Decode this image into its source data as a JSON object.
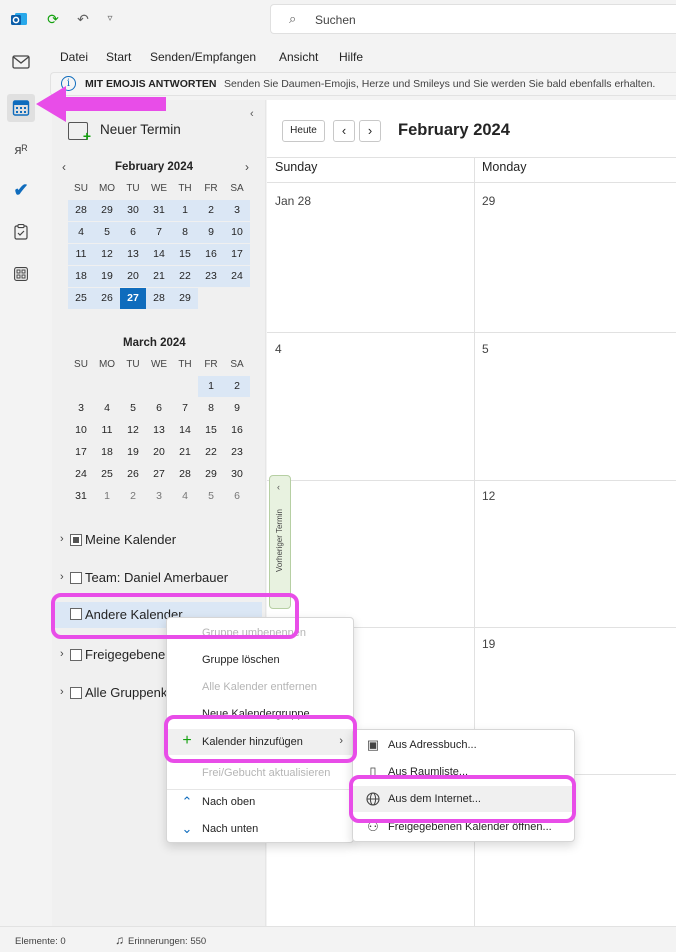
{
  "titlebar": {
    "search_placeholder": "Suchen",
    "icons": [
      "outlook-logo-icon",
      "sync-icon",
      "undo-icon",
      "customize-dropdown-icon"
    ]
  },
  "rail": {
    "items": [
      "mail-icon",
      "calendar-icon",
      "people-icon",
      "todo-icon",
      "tasks-icon",
      "apps-icon"
    ]
  },
  "menubar": {
    "items": [
      "Datei",
      "Start",
      "Senden/Empfangen",
      "Ansicht",
      "Hilfe"
    ]
  },
  "infobar": {
    "title": "MIT EMOJIS ANTWORTEN",
    "text": "Senden Sie Daumen-Emojis, Herze und Smileys und Sie werden Sie bald ebenfalls erhalten."
  },
  "leftpane": {
    "new_event": "Neuer Termin",
    "feb": {
      "title": "February 2024",
      "weekdays": [
        "SU",
        "MO",
        "TU",
        "WE",
        "TH",
        "FR",
        "SA"
      ],
      "weeks": [
        [
          "28",
          "29",
          "30",
          "31",
          "1",
          "2",
          "3"
        ],
        [
          "4",
          "5",
          "6",
          "7",
          "8",
          "9",
          "10"
        ],
        [
          "11",
          "12",
          "13",
          "14",
          "15",
          "16",
          "17"
        ],
        [
          "18",
          "19",
          "20",
          "21",
          "22",
          "23",
          "24"
        ],
        [
          "25",
          "26",
          "27",
          "28",
          "29",
          "",
          ""
        ]
      ],
      "selected_day": "27"
    },
    "mar": {
      "title": "March 2024",
      "weekdays": [
        "SU",
        "MO",
        "TU",
        "WE",
        "TH",
        "FR",
        "SA"
      ],
      "weeks": [
        [
          "",
          "",
          "",
          "",
          "",
          "1",
          "2"
        ],
        [
          "3",
          "4",
          "5",
          "6",
          "7",
          "8",
          "9"
        ],
        [
          "10",
          "11",
          "12",
          "13",
          "14",
          "15",
          "16"
        ],
        [
          "17",
          "18",
          "19",
          "20",
          "21",
          "22",
          "23"
        ],
        [
          "24",
          "25",
          "26",
          "27",
          "28",
          "29",
          "30"
        ],
        [
          "31",
          "1",
          "2",
          "3",
          "4",
          "5",
          "6"
        ]
      ]
    },
    "folders": [
      {
        "label": "Meine Kalender",
        "checked": true
      },
      {
        "label": "Team: Daniel Amerbauer",
        "checked": false
      },
      {
        "label": "Andere Kalender",
        "checked": false
      },
      {
        "label": "Freigegebene",
        "checked": false
      },
      {
        "label": "Alle Gruppenk",
        "checked": false
      }
    ]
  },
  "main": {
    "today_btn": "Heute",
    "month_title": "February 2024",
    "day_headers": [
      "Sunday",
      "Monday"
    ],
    "cells": [
      "Jan 28",
      "29",
      "4",
      "5",
      "12",
      "19"
    ],
    "prev_appointment": "Vorheriger Termin"
  },
  "context_menu": {
    "items": [
      {
        "label": "Gruppe umbenennen",
        "disabled": true
      },
      {
        "label": "Gruppe löschen",
        "disabled": false
      },
      {
        "label": "Alle Kalender entfernen",
        "disabled": true
      },
      {
        "label": "Neue Kalendergruppe",
        "disabled": false
      },
      {
        "label": "Kalender hinzufügen",
        "disabled": false
      },
      {
        "label": "Frei/Gebucht aktualisieren",
        "disabled": true
      },
      {
        "label": "Nach oben",
        "disabled": false
      },
      {
        "label": "Nach unten",
        "disabled": false
      }
    ]
  },
  "submenu": {
    "items": [
      {
        "label": "Aus Adressbuch...",
        "icon": "address-book-icon"
      },
      {
        "label": "Aus Raumliste...",
        "icon": "room-list-icon"
      },
      {
        "label": "Aus dem Internet...",
        "icon": "globe-icon"
      },
      {
        "label": "Freigegebenen Kalender öffnen...",
        "icon": "shared-calendar-icon"
      }
    ]
  },
  "statusbar": {
    "items": "Elemente: 0",
    "reminders": "Erinnerungen: 550"
  },
  "colors": {
    "accent": "#0f6cbd",
    "highlight": "#e84de8",
    "selection": "#dbe7f5"
  }
}
